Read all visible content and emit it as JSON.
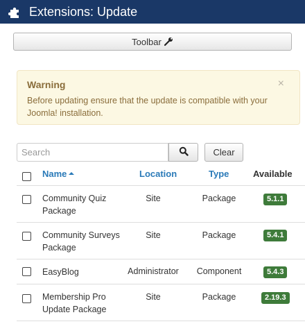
{
  "header": {
    "title": "Extensions: Update",
    "icon": "puzzle-piece-icon"
  },
  "toolbar": {
    "label": "Toolbar",
    "icon": "wrench-icon"
  },
  "alert": {
    "title": "Warning",
    "text": "Before updating ensure that the update is compatible with your Joomla! installation.",
    "close": "×"
  },
  "search": {
    "placeholder": "Search",
    "clear_label": "Clear"
  },
  "table": {
    "columns": {
      "name": "Name",
      "location": "Location",
      "type": "Type",
      "available": "Available"
    },
    "rows": [
      {
        "name": "Community Quiz Package",
        "location": "Site",
        "type": "Package",
        "available": "5.1.1"
      },
      {
        "name": "Community Surveys Package",
        "location": "Site",
        "type": "Package",
        "available": "5.4.1"
      },
      {
        "name": "EasyBlog",
        "location": "Administrator",
        "type": "Component",
        "available": "5.4.3"
      },
      {
        "name": "Membership Pro Update Package",
        "location": "Site",
        "type": "Package",
        "available": "2.19.3"
      }
    ]
  },
  "colors": {
    "header_bg": "#1a3867",
    "link": "#2a7ab8",
    "badge": "#3e7b3a",
    "alert_bg": "#fcf8e3"
  }
}
